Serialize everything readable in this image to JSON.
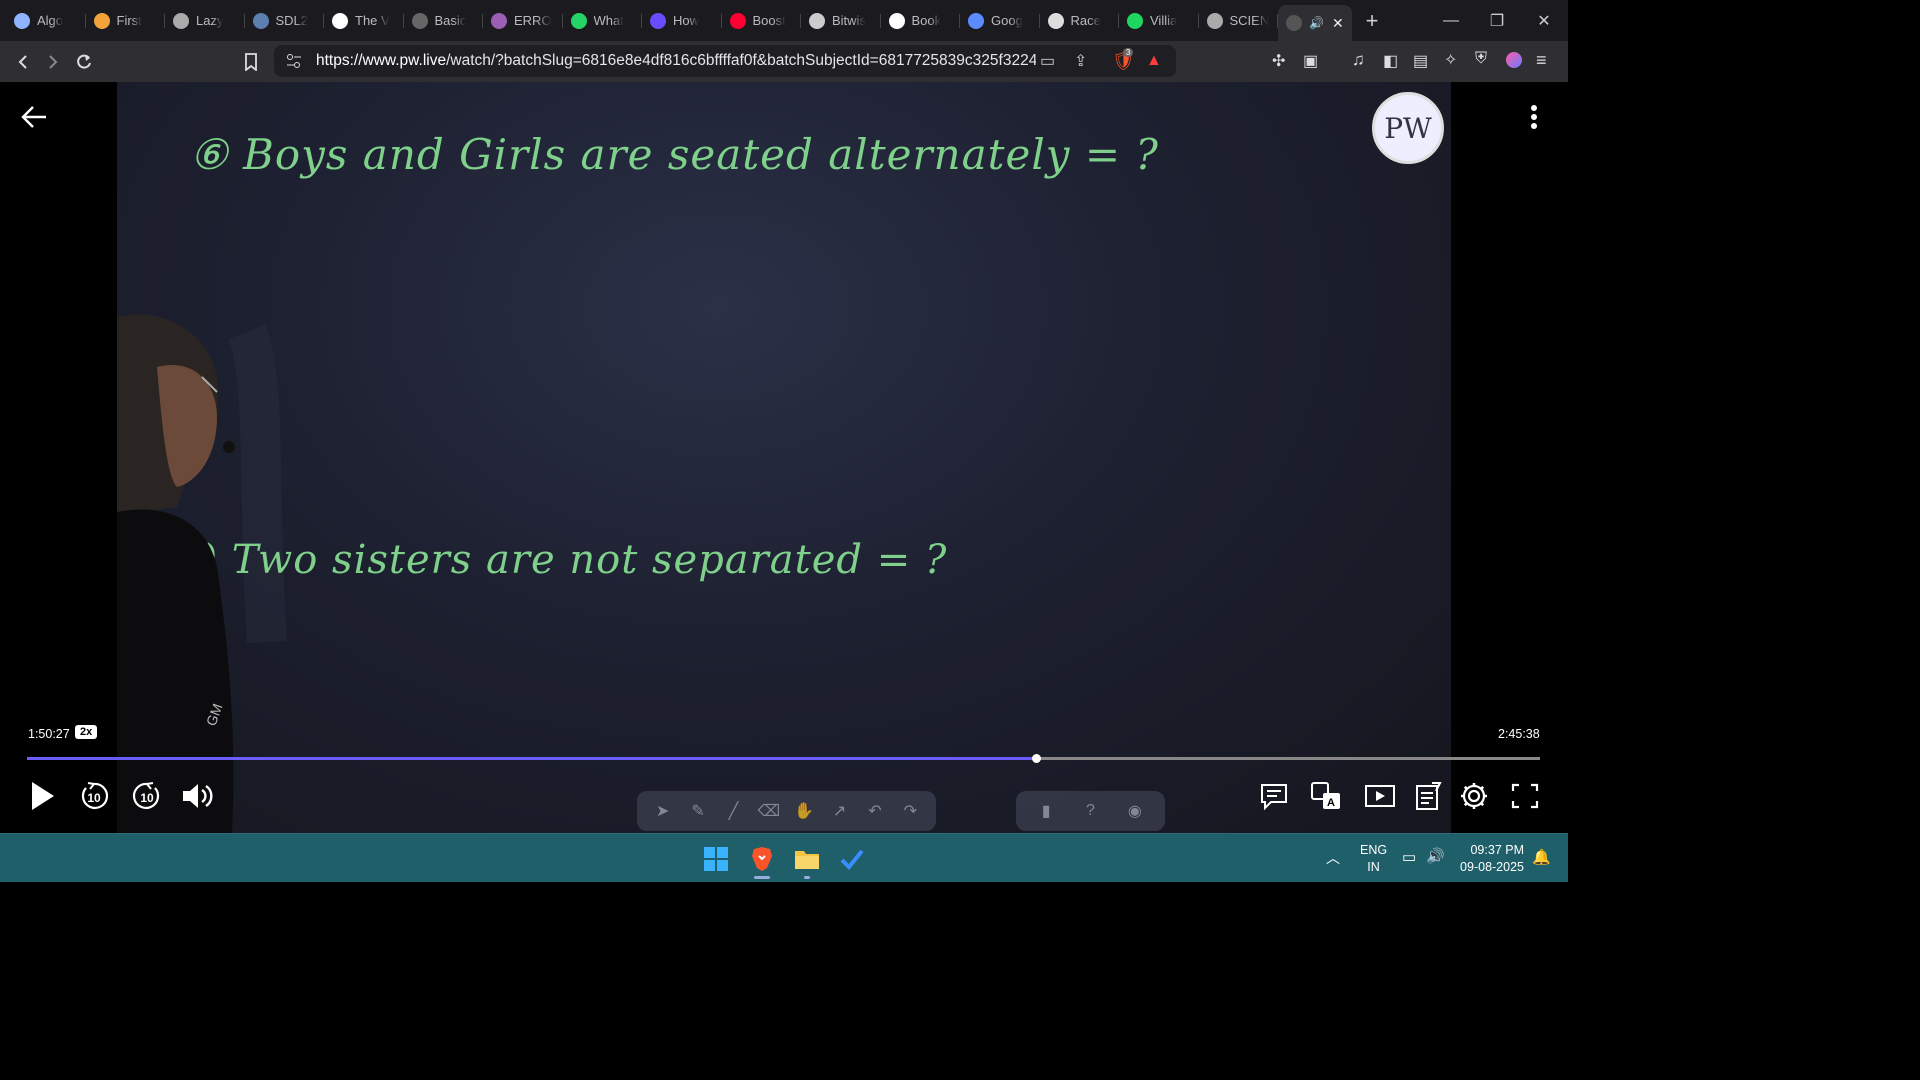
{
  "browser": {
    "tabs": [
      {
        "label": "Algo",
        "icon": "algo-icon",
        "color": "#8fb3ff"
      },
      {
        "label": "First",
        "icon": "first-icon",
        "color": "#f2a33a"
      },
      {
        "label": "Lazy",
        "icon": "globe-icon",
        "color": "#aaaaaa"
      },
      {
        "label": "SDL2",
        "icon": "sdl-icon",
        "color": "#5d7fb0"
      },
      {
        "label": "The V",
        "icon": "w3-icon",
        "color": "#ffffff"
      },
      {
        "label": "Basic",
        "icon": "basic-icon",
        "color": "#666666"
      },
      {
        "label": "ERRO",
        "icon": "erro-icon",
        "color": "#9a5fb5"
      },
      {
        "label": "What",
        "icon": "whatsapp-icon",
        "color": "#25d366"
      },
      {
        "label": "How",
        "icon": "how-icon",
        "color": "#6a4cff"
      },
      {
        "label": "Boost",
        "icon": "youtube-icon",
        "color": "#ff0033"
      },
      {
        "label": "Bitwis",
        "icon": "bitwise-icon",
        "color": "#cccccc"
      },
      {
        "label": "Book",
        "icon": "google-icon",
        "color": "#ffffff"
      },
      {
        "label": "Goog",
        "icon": "gemini-icon",
        "color": "#5b8cff"
      },
      {
        "label": "Race",
        "icon": "openai-icon",
        "color": "#dddddd"
      },
      {
        "label": "Villia",
        "icon": "spotify-icon",
        "color": "#1ed760"
      },
      {
        "label": "SCIEN",
        "icon": "globe-icon",
        "color": "#aaaaaa"
      }
    ],
    "url_host": "https://www.pw.live",
    "url_rest": "/watch/?batchSlug=6816e8e4df816c6bffffaf0f&batchSubjectId=6817725839c325f3224e28d...",
    "shield_count": "3"
  },
  "board": {
    "q6": "⑥ Boys and Girls are seated alternately = ?",
    "q7": "7) Two sisters are not separated = ?"
  },
  "player": {
    "current_time": "1:50:27",
    "speed": "2x",
    "total_time": "2:45:38",
    "progress_fraction": 0.6667,
    "skip_back": "10",
    "skip_forward": "10",
    "logo": "PW"
  },
  "taskbar": {
    "lang_line1": "ENG",
    "lang_line2": "IN",
    "time": "09:37 PM",
    "date": "09-08-2025"
  }
}
